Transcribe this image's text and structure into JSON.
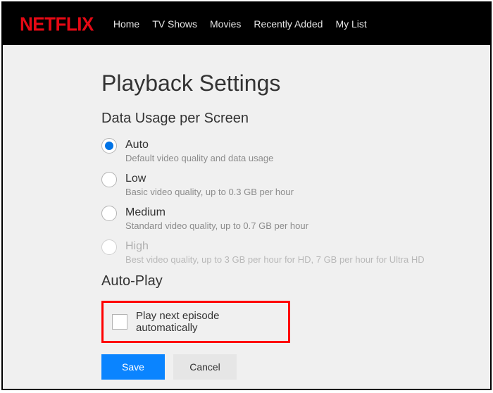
{
  "brand": "NETFLIX",
  "nav": {
    "home": "Home",
    "tvshows": "TV Shows",
    "movies": "Movies",
    "recent": "Recently Added",
    "mylist": "My List"
  },
  "page": {
    "title": "Playback Settings",
    "data_usage_heading": "Data Usage per Screen",
    "autoplay_heading": "Auto-Play"
  },
  "options": {
    "auto": {
      "label": "Auto",
      "desc": "Default video quality and data usage",
      "selected": true,
      "enabled": true
    },
    "low": {
      "label": "Low",
      "desc": "Basic video quality, up to 0.3 GB per hour",
      "selected": false,
      "enabled": true
    },
    "medium": {
      "label": "Medium",
      "desc": "Standard video quality, up to 0.7 GB per hour",
      "selected": false,
      "enabled": true
    },
    "high": {
      "label": "High",
      "desc": "Best video quality, up to 3 GB per hour for HD, 7 GB per hour for Ultra HD",
      "selected": false,
      "enabled": false
    }
  },
  "autoplay": {
    "label": "Play next episode automatically",
    "checked": false
  },
  "buttons": {
    "save": "Save",
    "cancel": "Cancel"
  },
  "colors": {
    "brand_red": "#e50914",
    "accent_blue": "#0a84ff",
    "highlight_red": "#ff0000"
  }
}
